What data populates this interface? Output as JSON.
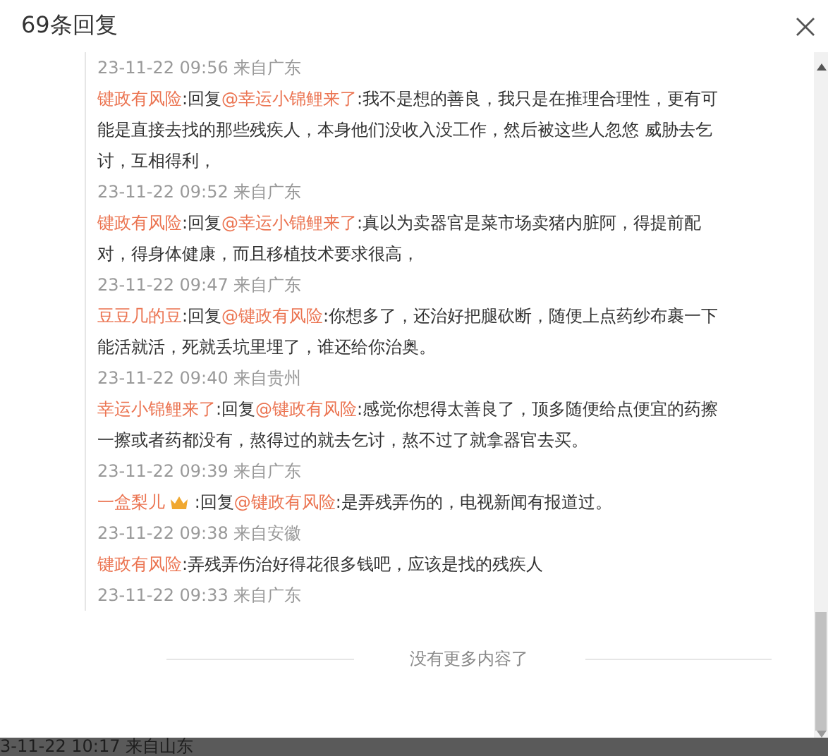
{
  "dialog": {
    "title": "69条回复"
  },
  "leading_time": "23-11-22 09:56 来自广东",
  "replies": [
    {
      "user": "键政有风险",
      "reply_label": ":回复",
      "mention": "@幸运小锦鲤来了",
      "badge": false,
      "text": ":我不是想的善良，我只是在推理合理性，更有可能是直接去找的那些残疾人，本身他们没收入没工作，然后被这些人忽悠 威胁去乞讨，互相得利，",
      "time": "23-11-22 09:52 来自广东"
    },
    {
      "user": "键政有风险",
      "reply_label": ":回复",
      "mention": "@幸运小锦鲤来了",
      "badge": false,
      "text": ":真以为卖器官是菜市场卖猪内脏阿，得提前配对，得身体健康，而且移植技术要求很高，",
      "time": "23-11-22 09:47 来自广东"
    },
    {
      "user": "豆豆几的豆",
      "reply_label": ":回复",
      "mention": "@键政有风险",
      "badge": false,
      "text": ":你想多了，还治好把腿砍断，随便上点药纱布裹一下能活就活，死就丢坑里埋了，谁还给你治奥。",
      "time": "23-11-22 09:40 来自贵州"
    },
    {
      "user": "幸运小锦鲤来了",
      "reply_label": ":回复",
      "mention": "@键政有风险",
      "badge": false,
      "text": ":感觉你想得太善良了，顶多随便给点便宜的药擦一擦或者药都没有，熬得过的就去乞讨，熬不过了就拿器官去买。",
      "time": "23-11-22 09:39 来自广东"
    },
    {
      "user": "一盒梨儿",
      "reply_label": " :回复",
      "mention": "@键政有风险",
      "badge": true,
      "text": ":是弄残弄伤的，电视新闻有报道过。",
      "time": "23-11-22 09:38 来自安徽"
    },
    {
      "user": "键政有风险",
      "text": ":弄残弄伤治好得花很多钱吧，应该是找的残疾人",
      "badge": false,
      "time": "23-11-22 09:33 来自广东"
    }
  ],
  "end_note": "没有更多内容了",
  "background_text": "3-11-22 10:17 来自山东"
}
